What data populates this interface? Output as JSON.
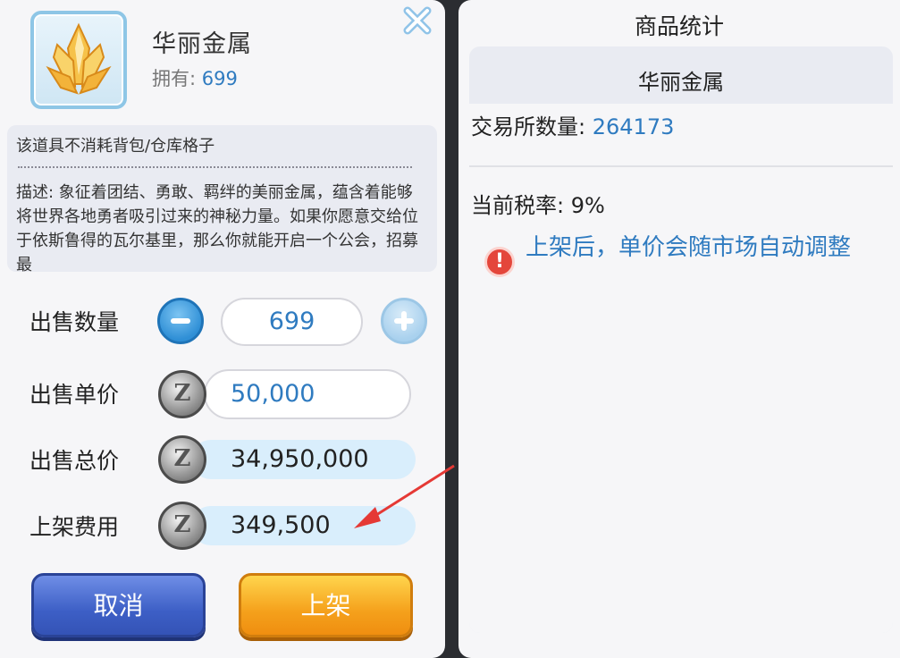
{
  "left_panel": {
    "item_name": "华丽金属",
    "owned_label": "拥有:",
    "owned_value": "699",
    "notice": "该道具不消耗背包/仓库格子",
    "description": "描述: 象征着团结、勇敢、羁绊的美丽金属，蕴含着能够将世界各地勇者吸引过来的神秘力量。如果你愿意交给位于依斯鲁得的瓦尔基里，那么你就能开启一个公会，招募最",
    "labels": {
      "quantity": "出售数量",
      "unit_price": "出售单价",
      "total_price": "出售总价",
      "listing_fee": "上架费用"
    },
    "quantity_value": "699",
    "unit_price_value": "50,000",
    "total_price_value": "34,950,000",
    "listing_fee_value": "349,500",
    "coin_symbol": "Z",
    "cancel_label": "取消",
    "list_label": "上架"
  },
  "right_panel": {
    "title": "商品统计",
    "item_name": "华丽金属",
    "exchange_label": "交易所数量:",
    "exchange_value": "264173",
    "tax_text": "当前税率: 9%",
    "warning_icon_glyph": "!",
    "warning_text": "上架后，单价会随市场自动调整"
  },
  "icons": [
    "crystal-item-icon",
    "close-icon",
    "minus-icon",
    "plus-icon",
    "zeny-coin-icon",
    "warning-icon",
    "red-arrow-annotation"
  ],
  "colors": {
    "accent_blue": "#2f7bc0",
    "cancel_button": "#3d5fc6",
    "list_button": "#f5a11c",
    "warning_red": "#e4463b",
    "annotation_red": "#e53935"
  }
}
